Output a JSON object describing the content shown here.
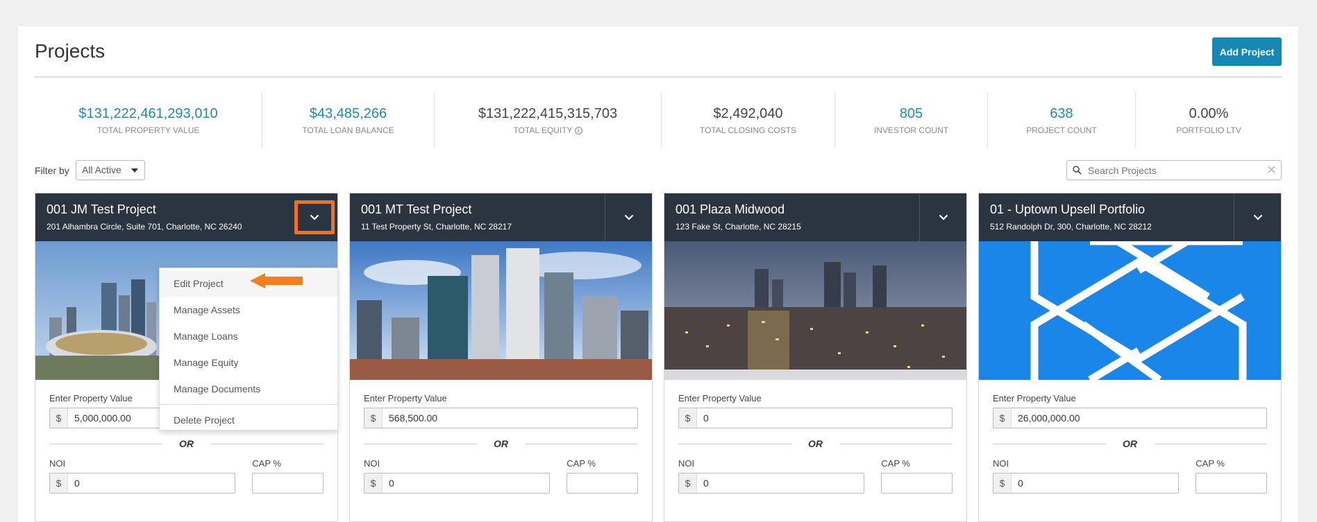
{
  "header": {
    "title": "Projects",
    "add_label": "Add Project"
  },
  "stats": [
    {
      "value": "$131,222,461,293,010",
      "label": "TOTAL PROPERTY VALUE",
      "blue": true
    },
    {
      "value": "$43,485,266",
      "label": "TOTAL LOAN BALANCE",
      "blue": true
    },
    {
      "value": "$131,222,415,315,703",
      "label": "TOTAL EQUITY",
      "blue": false
    },
    {
      "value": "$2,492,040",
      "label": "TOTAL CLOSING COSTS",
      "blue": false
    },
    {
      "value": "805",
      "label": "INVESTOR COUNT",
      "blue": true
    },
    {
      "value": "638",
      "label": "PROJECT COUNT",
      "blue": true
    },
    {
      "value": "0.00%",
      "label": "PORTFOLIO LTV",
      "blue": false
    }
  ],
  "filter": {
    "label": "Filter by",
    "value": "All Active"
  },
  "search": {
    "placeholder": "Search Projects"
  },
  "form_labels": {
    "property_value": "Enter Property Value",
    "or": "OR",
    "noi": "NOI",
    "cap": "CAP %",
    "currency": "$"
  },
  "cards": [
    {
      "title": "001 JM Test Project",
      "address": "201 Alhambra Circle, Suite 701, Charlotte, NC 26240",
      "property_value": "5,000,000.00",
      "noi": "0"
    },
    {
      "title": "001 MT Test Project",
      "address": "11 Test Property St, Charlotte, NC 28217",
      "property_value": "568,500.00",
      "noi": "0"
    },
    {
      "title": "001 Plaza Midwood",
      "address": "123 Fake St, Charlotte, NC 28215",
      "property_value": "0",
      "noi": "0"
    },
    {
      "title": "01 - Uptown Upsell Portfolio",
      "address": "512 Randolph Dr, 300, Charlotte, NC 28212",
      "property_value": "26,000,000.00",
      "noi": "0"
    }
  ],
  "dropdown": {
    "items": [
      "Edit Project",
      "Manage Assets",
      "Manage Loans",
      "Manage Equity",
      "Manage Documents"
    ],
    "delete_label": "Delete Project"
  },
  "colors": {
    "accent": "#1788b5",
    "header_dark": "#2b3441",
    "highlight": "#f36f21"
  }
}
